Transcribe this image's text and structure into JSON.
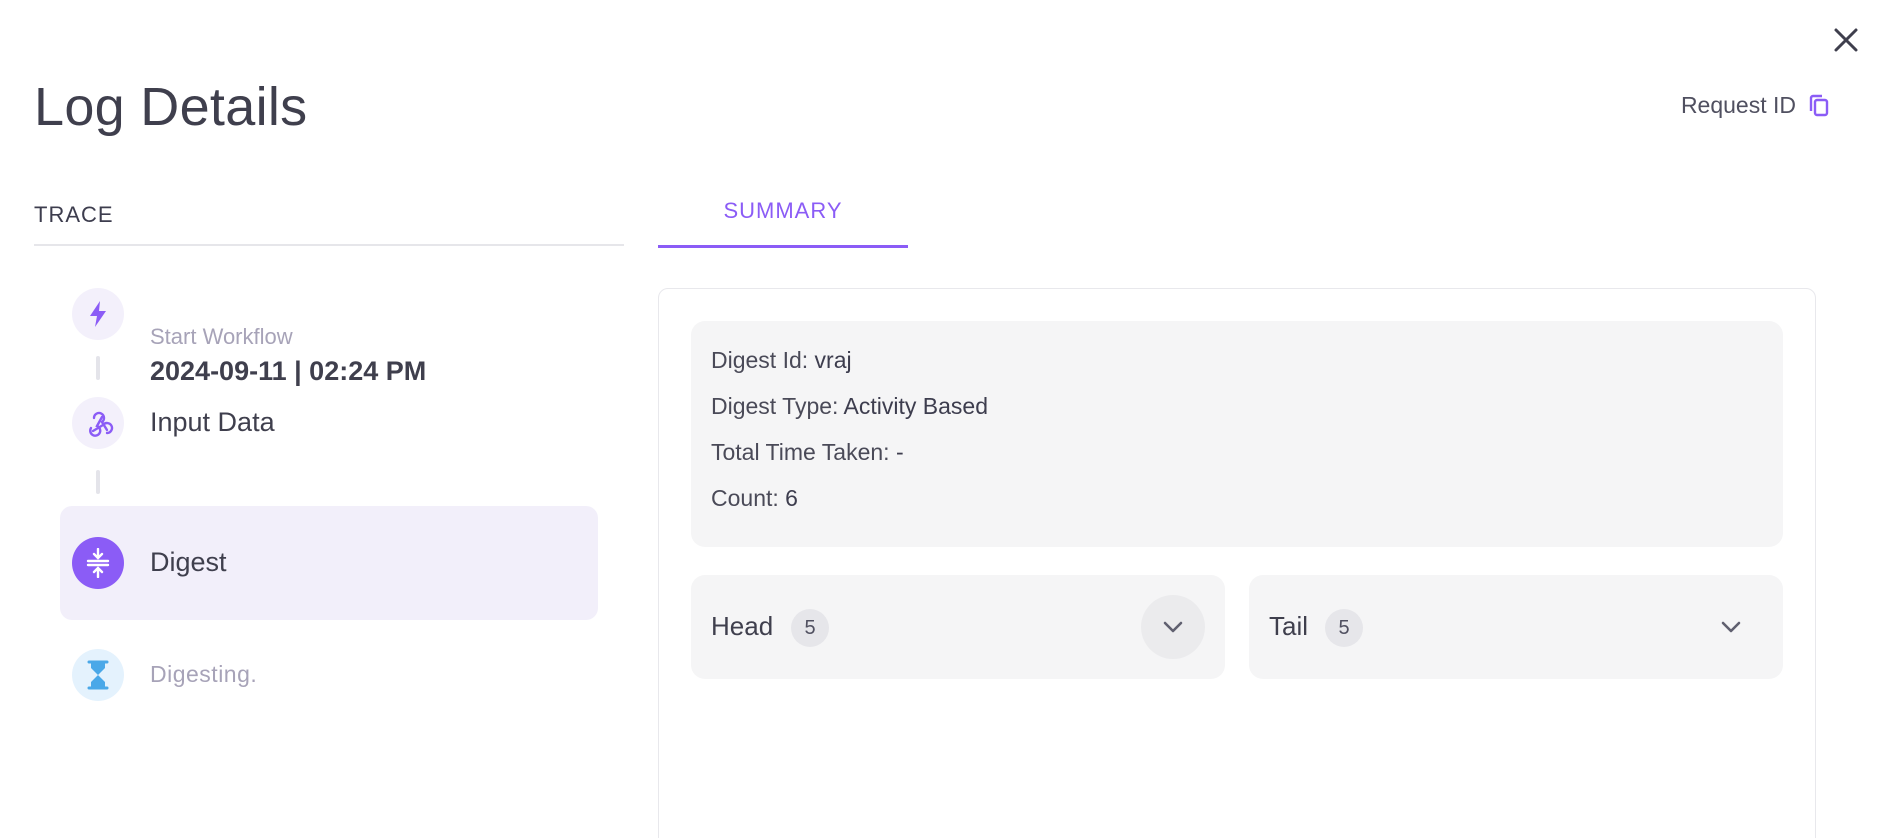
{
  "header": {
    "title": "Log Details",
    "request_id_label": "Request ID",
    "close_icon": "close-icon",
    "copy_icon": "copy-icon"
  },
  "trace": {
    "heading": "TRACE",
    "steps": [
      {
        "label": "Start Workflow",
        "value": "2024-09-11 | 02:24 PM",
        "icon": "lightning-icon",
        "status": "done"
      },
      {
        "label": "Input Data",
        "icon": "webhook-icon",
        "status": "done"
      },
      {
        "label": "Digest",
        "icon": "digest-compress-icon",
        "status": "active"
      },
      {
        "label": "Digesting",
        "icon": "hourglass-icon",
        "status": "pending",
        "loader": "."
      }
    ]
  },
  "summary": {
    "tab_label": "SUMMARY",
    "fields": [
      {
        "key": "Digest Id:",
        "value": "vraj"
      },
      {
        "key": "Digest Type:",
        "value": "Activity Based"
      },
      {
        "key": "Total Time Taken:",
        "value": "-"
      },
      {
        "key": "Count:",
        "value": "6"
      }
    ],
    "head": {
      "label": "Head",
      "count": "5",
      "icon": "chevron-down-icon"
    },
    "tail": {
      "label": "Tail",
      "count": "5",
      "icon": "chevron-down-icon"
    }
  },
  "colors": {
    "accent": "#8b5cf6",
    "active_bg": "#f2effa",
    "panel_bg": "#f5f5f6",
    "pending_icon": "#4aa8e8"
  }
}
